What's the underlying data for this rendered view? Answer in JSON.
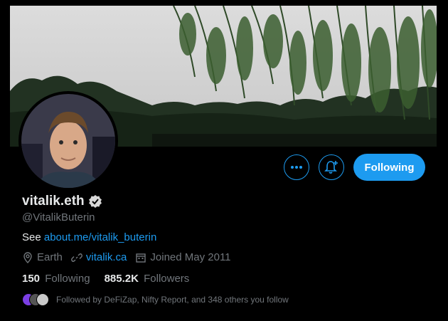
{
  "profile": {
    "display_name": "vitalik.eth",
    "handle": "@VitalikButerin",
    "bio_prefix": "See ",
    "bio_link": "about.me/vitalik_buterin",
    "location": "Earth",
    "website": "vitalik.ca",
    "joined": "Joined May 2011",
    "following_count": "150",
    "following_label": "Following",
    "followers_count": "885.2K",
    "followers_label": "Followers",
    "followed_by": "Followed by DeFiZap, Nifty Report, and 348 others you follow"
  },
  "actions": {
    "more_icon": "more-icon",
    "notify_icon": "bell-plus-icon",
    "follow_label": "Following"
  },
  "colors": {
    "accent": "#1d9bf0",
    "background": "#000000",
    "text": "#e7e9ea",
    "muted": "#71767b"
  }
}
